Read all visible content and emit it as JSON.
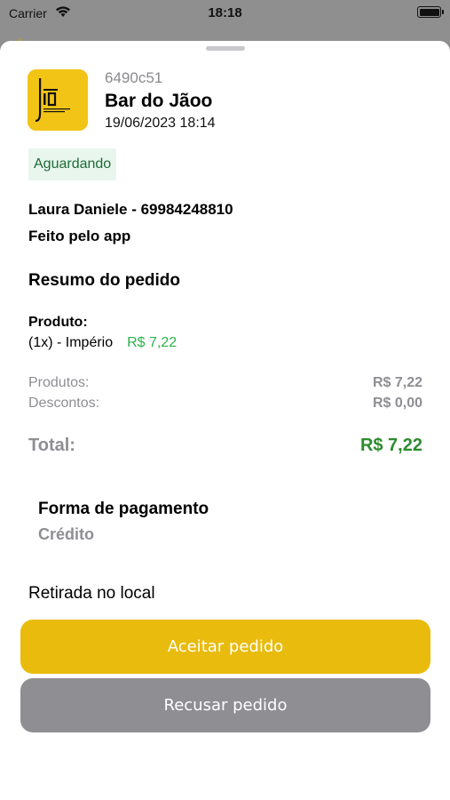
{
  "status_bar": {
    "carrier": "Carrier",
    "time": "18:18",
    "wifi_icon": "wifi-icon",
    "battery_icon": "battery-icon"
  },
  "order": {
    "code": "6490c51",
    "store_name": "Bar do Jãoo",
    "date": "19/06/2023 18:14",
    "status": "Aguardando",
    "customer": "Laura Daniele - 69984248810",
    "source": "Feito pelo app"
  },
  "summary": {
    "title": "Resumo do pedido",
    "product_heading": "Produto:",
    "items": [
      {
        "desc": "(1x) - Império",
        "price": "R$ 7,22"
      }
    ],
    "products_label": "Produtos:",
    "products_value": "R$ 7,22",
    "discounts_label": "Descontos:",
    "discounts_value": "R$ 0,00",
    "total_label": "Total:",
    "total_value": "R$ 7,22"
  },
  "payment": {
    "title": "Forma de pagamento",
    "method": "Crédito"
  },
  "delivery": {
    "mode": "Retirada no local"
  },
  "actions": {
    "accept_label": "Aceitar pedido",
    "refuse_label": "Recusar pedido"
  },
  "colors": {
    "accent": "#e9bb0c",
    "status_bg": "#e8f6ee",
    "status_text": "#1e6b36",
    "price_green": "#2bb24c",
    "total_green": "#2e8b2e",
    "secondary_gray": "#8e8e93"
  }
}
